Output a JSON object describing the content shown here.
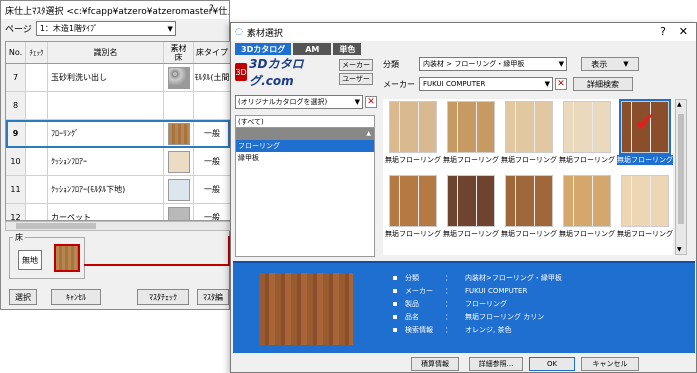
{
  "back_window": {
    "title": "床仕上ﾏｽﾀ選択 <c:¥fcapp¥atzero¥atzeromaster¥仕上¥住宅用>",
    "page_label": "ページ",
    "page_value": "1：木造1階ﾀｲﾌﾟ",
    "columns": {
      "no": "No.",
      "check": "ﾁｪｯｸ",
      "name": "識別名",
      "material": "素材",
      "material_sub": "床",
      "type": "床タイプ"
    },
    "rows": [
      {
        "no": "7",
        "name": "玉砂利洗い出し",
        "type": "ﾓﾙﾀﾙ(土間"
      },
      {
        "no": "8",
        "name": "",
        "type": ""
      },
      {
        "no": "9",
        "name": "ﾌﾛｰﾘﾝｸﾞ",
        "type": "一般"
      },
      {
        "no": "10",
        "name": "ｸｯｼｮﾝﾌﾛｱｰ",
        "type": "一般"
      },
      {
        "no": "11",
        "name": "ｸｯｼｮﾝﾌﾛｱｰ(ﾓﾙﾀﾙ下地)",
        "type": "一般"
      },
      {
        "no": "12",
        "name": "カーペット",
        "type": "一般"
      }
    ],
    "floor_group_label": "床",
    "muji_label": "無地",
    "buttons": {
      "select": "選択",
      "cancel": "ｷｬﾝｾﾙ",
      "master_check": "ﾏｽﾀﾁｪｯｸ",
      "master_edit": "ﾏｽﾀ編"
    },
    "close_glyph": "?"
  },
  "dialog": {
    "title": "素材選択",
    "help_glyph": "?",
    "close_glyph": "✕",
    "tabs": [
      "3Dカタログ",
      "AM",
      "単色"
    ],
    "logo_mark": "3D",
    "logo_text": "3Dカタログ.com",
    "maker_btn": "メーカー",
    "user_btn": "ユーザー",
    "catalog_select": "(オリジナルカタログを選択)",
    "category_all": "(すべて)",
    "categories": [
      "フローリング",
      "縁甲板"
    ],
    "bunrui_label": "分類",
    "bunrui_value": "内装材 > フローリング・縁甲板",
    "maker_label": "メーカー",
    "maker_value": "FUKUI COMPUTER",
    "view_btn": "表示",
    "detail_btn": "詳細検索",
    "thumbnails": [
      {
        "label": "無垢フローリング...",
        "color": "#d9b98f"
      },
      {
        "label": "無垢フローリング...",
        "color": "#c79a64"
      },
      {
        "label": "無垢フローリング...",
        "color": "#e2c8a0"
      },
      {
        "label": "無垢フローリング...",
        "color": "#ead9bd"
      },
      {
        "label": "無垢フローリング...",
        "color": "#8a4f2a"
      },
      {
        "label": "無垢フローリング...",
        "color": "#b57a44"
      },
      {
        "label": "無垢フローリング...",
        "color": "#6e4430"
      },
      {
        "label": "無垢フローリング...",
        "color": "#a0683a"
      },
      {
        "label": "無垢フローリング...",
        "color": "#d4a86c"
      },
      {
        "label": "無垢フローリング...",
        "color": "#ecd6b4"
      }
    ],
    "info": [
      {
        "key": "分類",
        "value": "内装材>フローリング・縁甲板"
      },
      {
        "key": "メーカー",
        "value": "FUKUI COMPUTER"
      },
      {
        "key": "製品",
        "value": "フローリング"
      },
      {
        "key": "品名",
        "value": "無垢フローリング カリン"
      },
      {
        "key": "検索情報",
        "value": "オレンジ, 茶色"
      }
    ],
    "footer": {
      "estimate": "積算情報",
      "detail": "詳細参照...",
      "ok": "OK",
      "cancel": "キャンセル"
    }
  }
}
